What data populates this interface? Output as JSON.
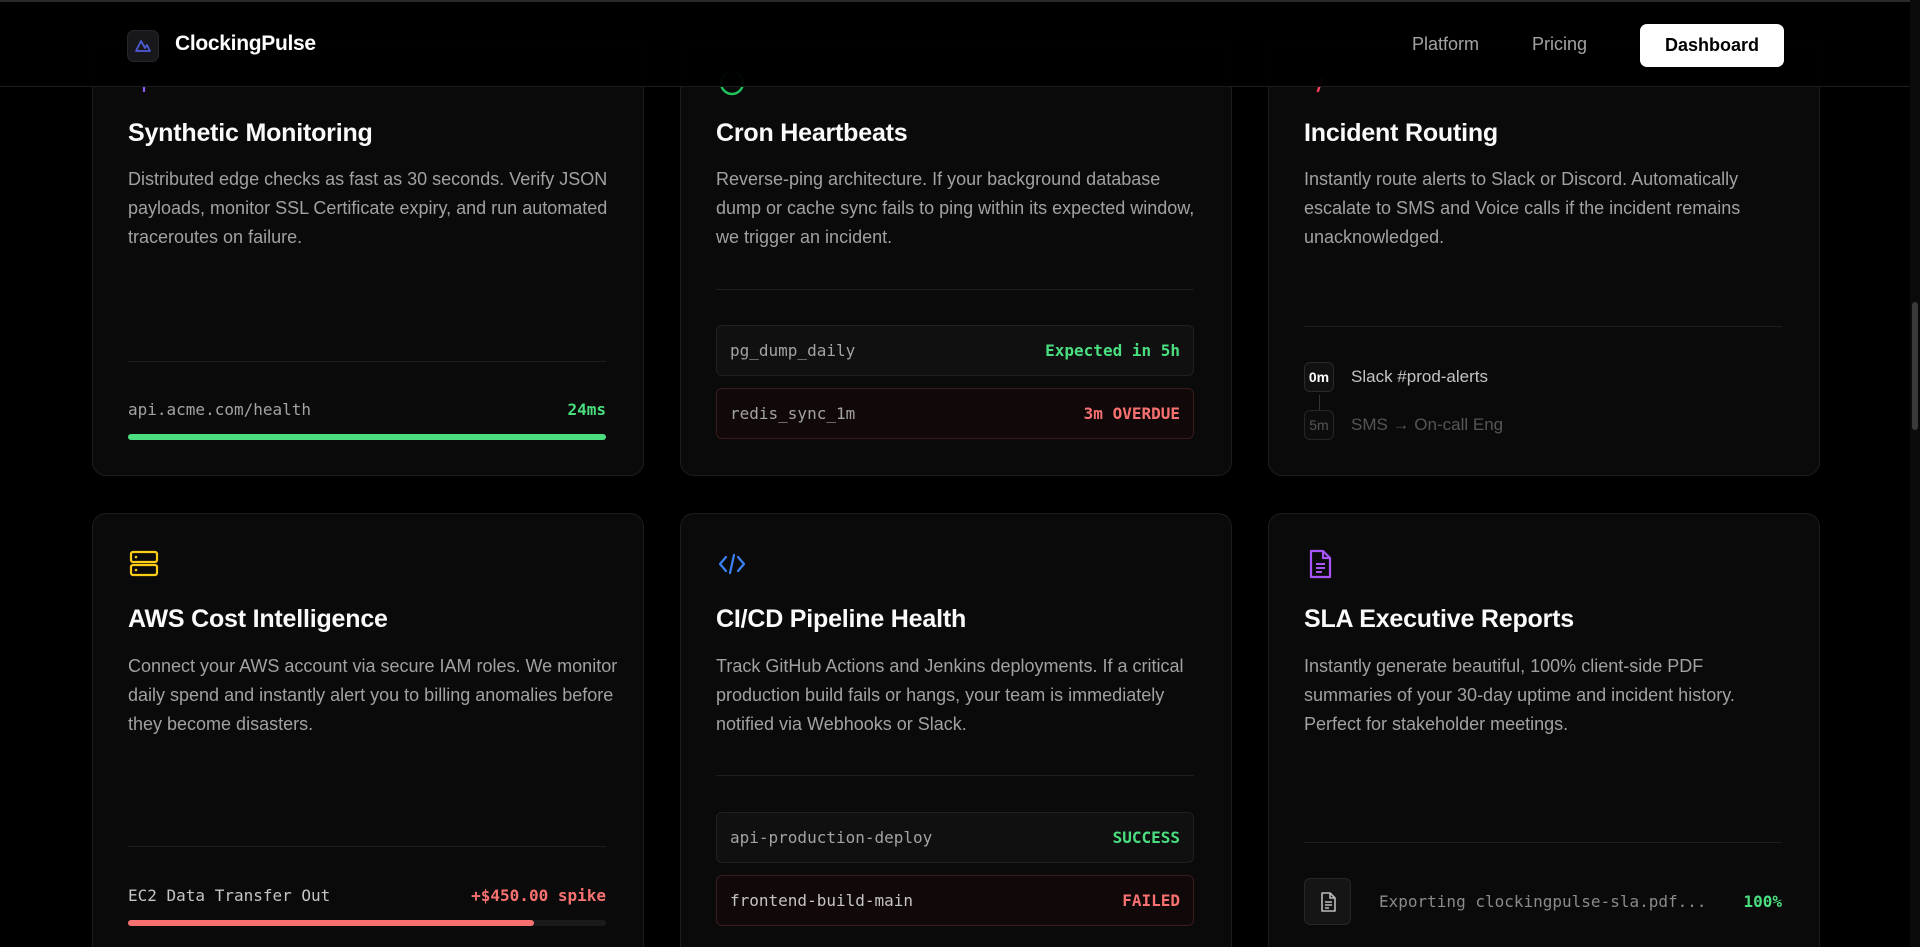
{
  "nav": {
    "brand": "ClockingPulse",
    "links": [
      "Platform",
      "Pricing"
    ],
    "cta": "Dashboard"
  },
  "cards": {
    "synthetic": {
      "title": "Synthetic Monitoring",
      "desc": "Distributed edge checks as fast as 30 seconds. Verify JSON payloads, monitor SSL Certificate expiry, and run automated traceroutes on failure.",
      "endpoint": "api.acme.com/health",
      "latency": "24ms",
      "progress": 1.0,
      "accent": "#4ade80"
    },
    "cron": {
      "title": "Cron Heartbeats",
      "desc": "Reverse-ping architecture. If your background database dump or cache sync fails to ping within its expected window, we trigger an incident.",
      "jobs": [
        {
          "name": "pg_dump_daily",
          "status": "Expected in 5h",
          "color": "#4ade80"
        },
        {
          "name": "redis_sync_1m",
          "status": "3m OVERDUE",
          "color": "#f87171"
        }
      ]
    },
    "routing": {
      "title": "Incident Routing",
      "desc": "Instantly route alerts to Slack or Discord. Automatically escalate to SMS and Voice calls if the incident remains unacknowledged.",
      "steps": [
        {
          "time": "0m",
          "target": "Slack #prod-alerts"
        },
        {
          "time": "5m",
          "target": "SMS → On-call Eng"
        }
      ]
    },
    "aws": {
      "title": "AWS Cost Intelligence",
      "desc": "Connect your AWS account via secure IAM roles. We monitor daily spend and instantly alert you to billing anomalies before they become disasters.",
      "metric_label": "EC2 Data Transfer Out",
      "metric_value": "+$450.00 spike",
      "progress": 0.85,
      "accent": "#f87171"
    },
    "cicd": {
      "title": "CI/CD Pipeline Health",
      "desc": "Track GitHub Actions and Jenkins deployments. If a critical production build fails or hangs, your team is immediately notified via Webhooks or Slack.",
      "jobs": [
        {
          "name": "api-production-deploy",
          "status": "SUCCESS",
          "color": "#4ade80"
        },
        {
          "name": "frontend-build-main",
          "status": "FAILED",
          "color": "#f87171"
        }
      ]
    },
    "sla": {
      "title": "SLA Executive Reports",
      "desc": "Instantly generate beautiful, 100% client-side PDF summaries of your 30-day uptime and incident history. Perfect for stakeholder meetings.",
      "export_text": "Exporting clockingpulse-sla.pdf...",
      "export_pct": "100%"
    }
  },
  "colors": {
    "green": "#4ade80",
    "red": "#f87171",
    "yellow": "#facc15",
    "blue": "#3b82f6",
    "purple": "#a855f7"
  },
  "icons": {
    "logo": "pulse-logo-icon",
    "aws": "server-stack-icon",
    "cicd": "code-brackets-icon",
    "sla": "document-icon",
    "export": "document-icon"
  }
}
